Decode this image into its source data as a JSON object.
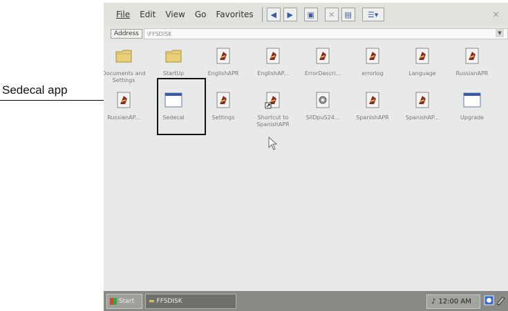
{
  "callout": {
    "label": "Sedecal app"
  },
  "menubar": {
    "items": [
      "File",
      "Edit",
      "View",
      "Go",
      "Favorites"
    ],
    "close": "×"
  },
  "addressbar": {
    "label": "Address",
    "value": "\\FFSDISK"
  },
  "files": [
    {
      "label": "Documents and Settings",
      "icon": "folder-icon"
    },
    {
      "label": "StartUp",
      "icon": "folder-icon"
    },
    {
      "label": "EnglishAPR",
      "icon": "app-file-icon"
    },
    {
      "label": "EnglishAP...",
      "icon": "app-file-icon"
    },
    {
      "label": "ErrorDescri...",
      "icon": "app-file-icon"
    },
    {
      "label": "errorlog",
      "icon": "app-file-icon"
    },
    {
      "label": "Language",
      "icon": "app-file-icon"
    },
    {
      "label": "RussianAPR",
      "icon": "app-file-icon"
    },
    {
      "label": "RussianAP...",
      "icon": "app-file-icon"
    },
    {
      "label": "Sedecal",
      "icon": "window-app-icon"
    },
    {
      "label": "Settings",
      "icon": "app-file-icon"
    },
    {
      "label": "Shortcut to SpanishAPR",
      "icon": "shortcut-icon"
    },
    {
      "label": "SiIDpuS24...",
      "icon": "gear-file-icon"
    },
    {
      "label": "SpanishAPR",
      "icon": "app-file-icon"
    },
    {
      "label": "SpanishAP...",
      "icon": "app-file-icon"
    },
    {
      "label": "Upgrade",
      "icon": "window-app-icon"
    }
  ],
  "taskbar": {
    "start": "Start",
    "task": "FFSDISK",
    "clock": "12:00 AM"
  },
  "colors": {
    "highlight": "#111111",
    "taskbar": "#888a86",
    "window_icon_bar": "#3a5aa8"
  }
}
